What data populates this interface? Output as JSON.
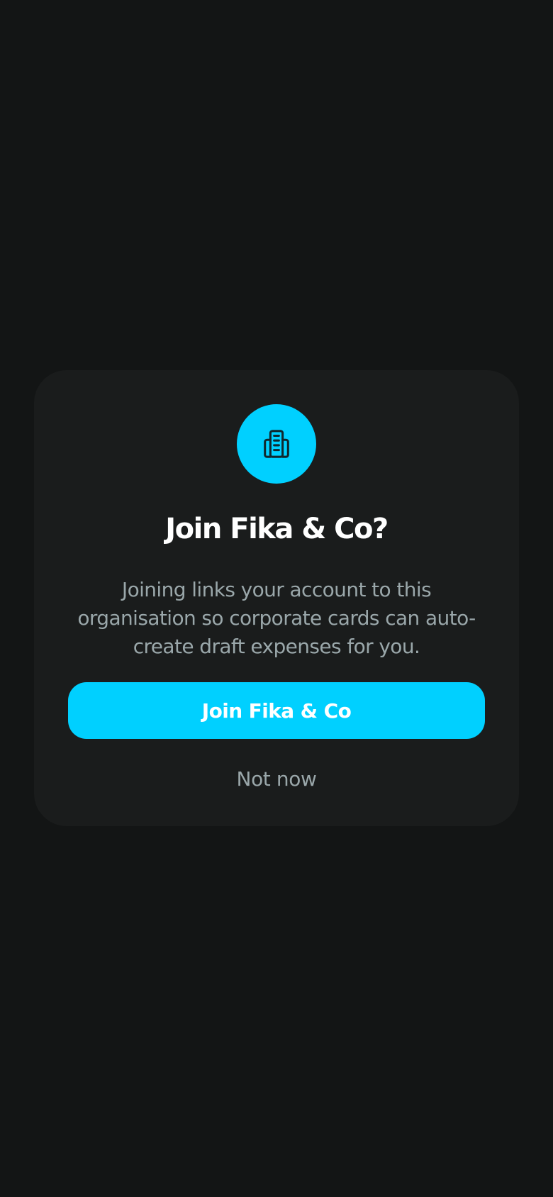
{
  "dialog": {
    "icon": "building-icon",
    "title": "Join Fika & Co?",
    "description": "Joining links your account to this organisation so corporate cards can auto-create draft expenses for you.",
    "primary_label": "Join Fika & Co",
    "secondary_label": "Not now"
  },
  "colors": {
    "background": "#131515",
    "card": "#1a1c1c",
    "accent": "#00d0ff",
    "muted_text": "#9aa7aa",
    "title_text": "#ffffff"
  }
}
